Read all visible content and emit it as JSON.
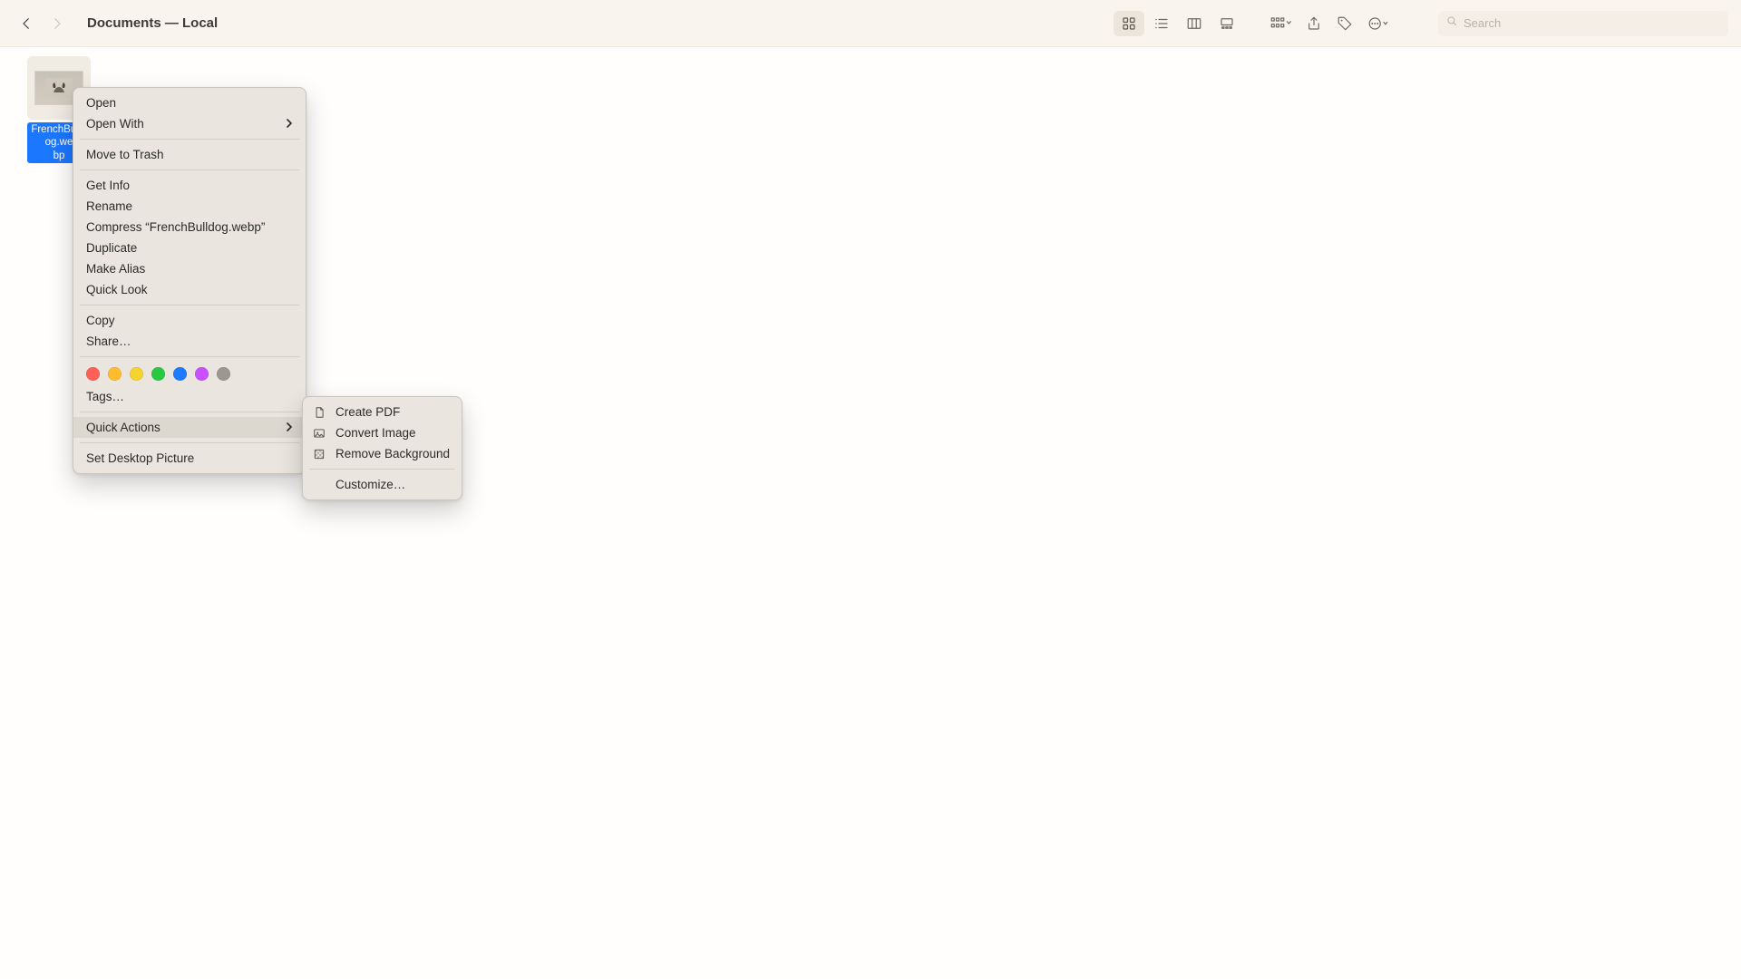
{
  "window": {
    "title": "Documents — Local"
  },
  "toolbar": {
    "search_placeholder": "Search"
  },
  "file": {
    "name_line1": "FrenchBulldog.we",
    "name_line2": "bp"
  },
  "context_menu": {
    "open": "Open",
    "open_with": "Open With",
    "move_to_trash": "Move to Trash",
    "get_info": "Get Info",
    "rename": "Rename",
    "compress": "Compress “FrenchBulldog.webp”",
    "duplicate": "Duplicate",
    "make_alias": "Make Alias",
    "quick_look": "Quick Look",
    "copy": "Copy",
    "share": "Share…",
    "tags": "Tags…",
    "quick_actions": "Quick Actions",
    "set_desktop_picture": "Set Desktop Picture"
  },
  "tag_colors": [
    "#fe5f57",
    "#febc2e",
    "#f7d330",
    "#28c840",
    "#1e7bff",
    "#c750ff",
    "#9b9892"
  ],
  "quick_actions_submenu": {
    "create_pdf": "Create PDF",
    "convert_image": "Convert Image",
    "remove_background": "Remove Background",
    "customize": "Customize…"
  }
}
